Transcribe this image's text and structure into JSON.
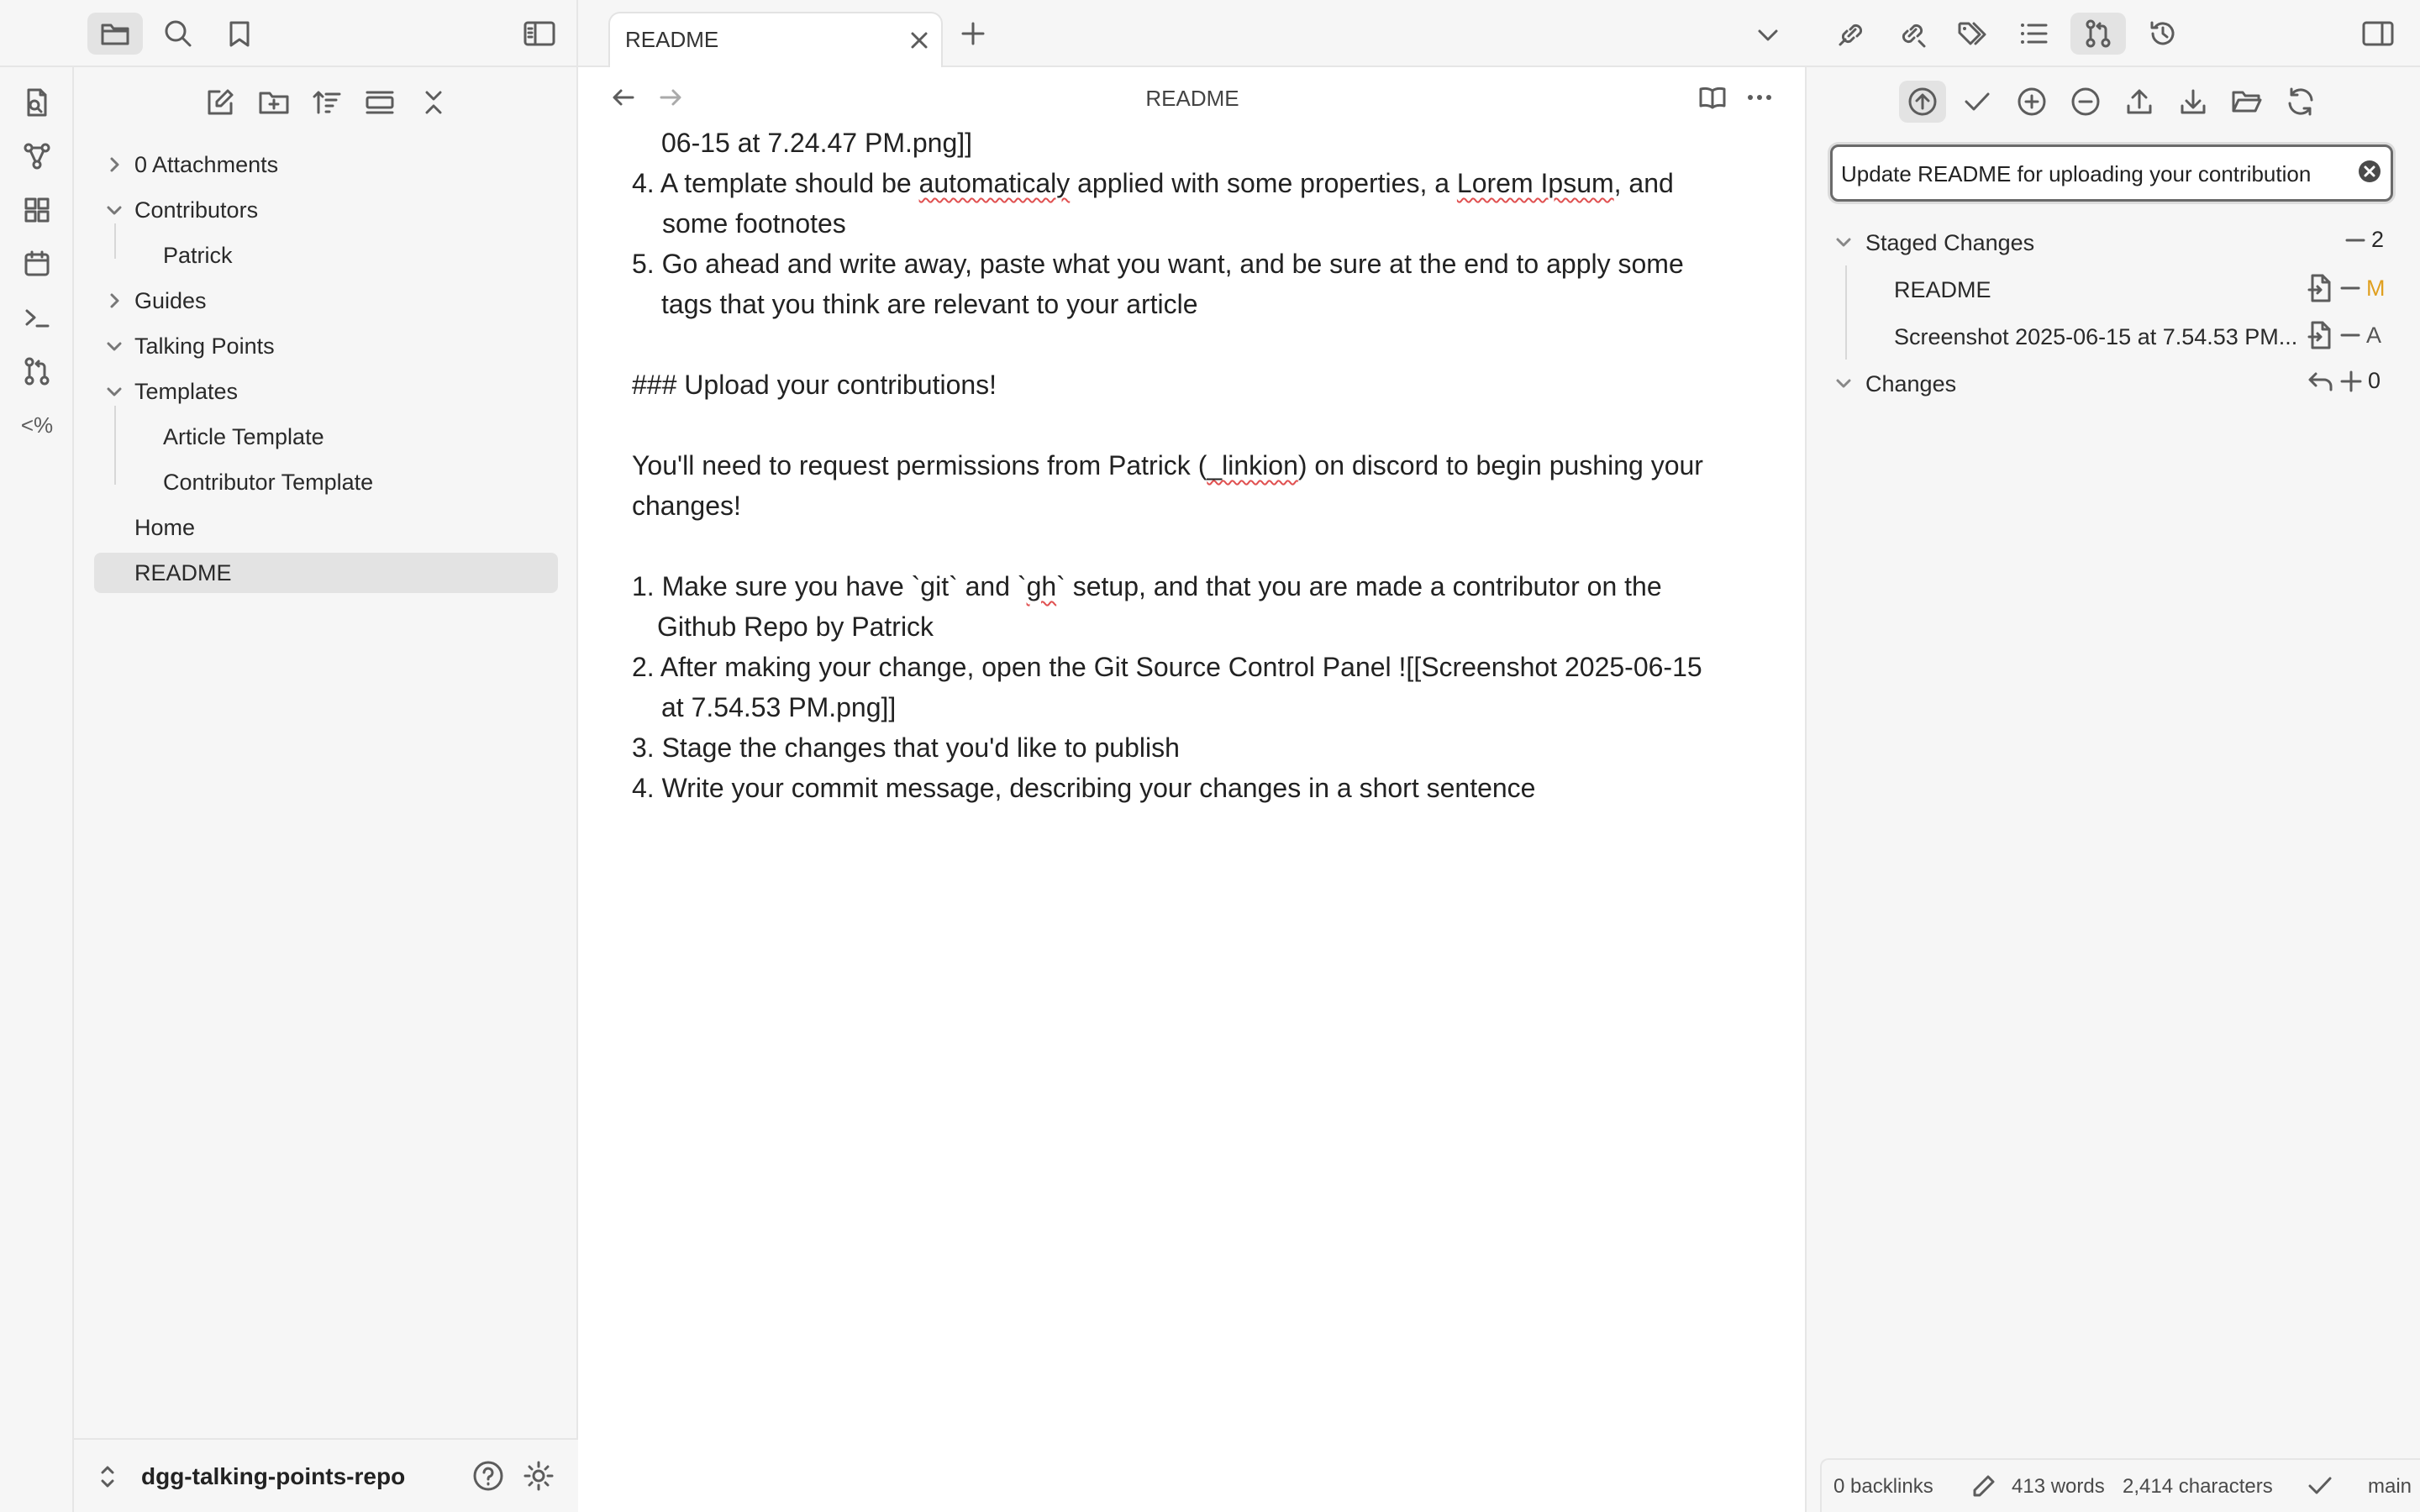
{
  "tab": {
    "title": "README"
  },
  "view_header": {
    "title": "README"
  },
  "explorer": {
    "items": [
      {
        "label": "0 Attachments"
      },
      {
        "label": "Contributors"
      },
      {
        "label": "Patrick"
      },
      {
        "label": "Guides"
      },
      {
        "label": "Talking Points"
      },
      {
        "label": "Templates"
      },
      {
        "label": "Article Template"
      },
      {
        "label": "Contributor Template"
      },
      {
        "label": "Home"
      },
      {
        "label": "README"
      }
    ],
    "vault_name": "dgg-talking-points-repo"
  },
  "content": {
    "l1": "06-15 at 7.24.47 PM.png]]",
    "l2a": "4. A template should be ",
    "l2b": "automaticaly",
    "l2c": " applied with some properties, a ",
    "l2d": "Lorem Ipsum",
    "l2e": ", and",
    "l3": "some footnotes",
    "l4": "5. Go ahead and write away, paste what you want, and be sure at the end to apply some",
    "l5": "tags that you think are relevant to your article",
    "l6": "### Upload your contributions!",
    "l7a": "You'll need to request permissions from Patrick (",
    "l7b": "_linkion",
    "l7c": ") on discord to begin pushing your",
    "l8": "changes!",
    "l9a": "1. Make sure you have `git` and `",
    "l9b": "gh",
    "l9c": "` setup, and that you are made a contributor on the",
    "l10": "Github Repo by Patrick",
    "l11": "2. After making your change, open the Git Source Control Panel ![[Screenshot 2025-06-15",
    "l12": "at 7.54.53 PM.png]]",
    "l13": "3. Stage the changes that you'd like to publish",
    "l14": "4. Write your commit message, describing your changes in a short sentence"
  },
  "git": {
    "commit_message": "Update README for uploading your contribution",
    "staged": {
      "label": "Staged Changes",
      "count": "2"
    },
    "files": [
      {
        "name": "README",
        "status": "M"
      },
      {
        "name": "Screenshot 2025-06-15 at 7.54.53 PM...",
        "status": "A"
      }
    ],
    "changes": {
      "label": "Changes",
      "count": "0"
    },
    "colors": {
      "modified": "#e0a020",
      "added": "#555555"
    }
  },
  "status": {
    "backlinks": "0 backlinks",
    "words": "413 words",
    "characters": "2,414 characters",
    "branch": "main"
  }
}
